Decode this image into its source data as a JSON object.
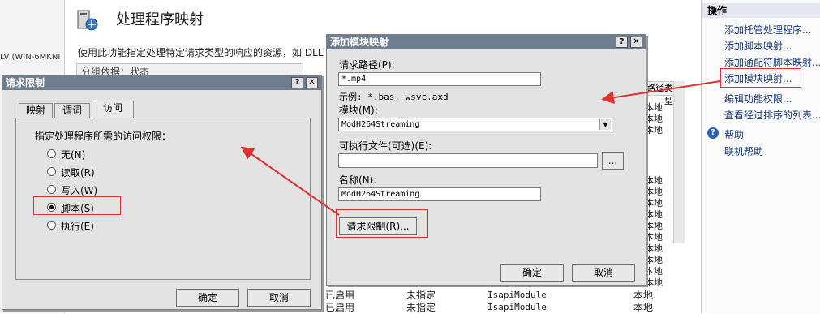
{
  "background": {
    "left_host": "LV (WIN-6MKNI",
    "page_title": "处理程序映射",
    "page_description": "使用此功能指定处理特定请求类型的响应的资源，如 DLL",
    "group_by": "分组依据：状态",
    "column_right": "路径类型",
    "rows_right": [
      "本地",
      "本地",
      "本地",
      "本地",
      "本地",
      "本地",
      "本地",
      "本地",
      "本地",
      "本地",
      "本地",
      "本地",
      "本地"
    ],
    "bottom_rows": [
      {
        "state": "已启用",
        "path": "未指定",
        "handler": "IsapiModule",
        "type": "本地"
      },
      {
        "state": "已启用",
        "path": "未指定",
        "handler": "IsapiModule",
        "type": "本地"
      }
    ]
  },
  "actions_pane": {
    "title": "操作",
    "links": [
      "添加托管处理程序...",
      "添加脚本映射...",
      "添加通配符脚本映射...",
      "添加模块映射...",
      "编辑功能权限...",
      "查看经过排序的列表..."
    ],
    "help": "帮助",
    "online_help": "联机帮助"
  },
  "request_restrictions": {
    "title": "请求限制",
    "tabs": [
      "映射",
      "谓词",
      "访问"
    ],
    "prompt": "指定处理程序所需的访问权限：",
    "options": [
      "无(N)",
      "读取(R)",
      "写入(W)",
      "脚本(S)",
      "执行(E)"
    ],
    "selected": "脚本(S)",
    "ok": "确定",
    "cancel": "取消"
  },
  "add_module_mapping": {
    "title": "添加模块映射",
    "request_path_label": "请求路径(P):",
    "request_path_value": "*.mp4",
    "example": "示例: *.bas, wsvc.axd",
    "module_label": "模块(M):",
    "module_value": "ModH264Streaming",
    "executable_label": "可执行文件(可选)(E):",
    "executable_value": "",
    "browse": "...",
    "name_label": "名称(N):",
    "name_value": "ModH264Streaming",
    "request_restrictions_button": "请求限制(R)...",
    "ok": "确定",
    "cancel": "取消"
  },
  "colors": {
    "titlebar": "#6e7e8e",
    "dialog_bg": "#e3e3e3",
    "annotation_red": "#e03030",
    "link_blue": "#1a3c7a"
  }
}
